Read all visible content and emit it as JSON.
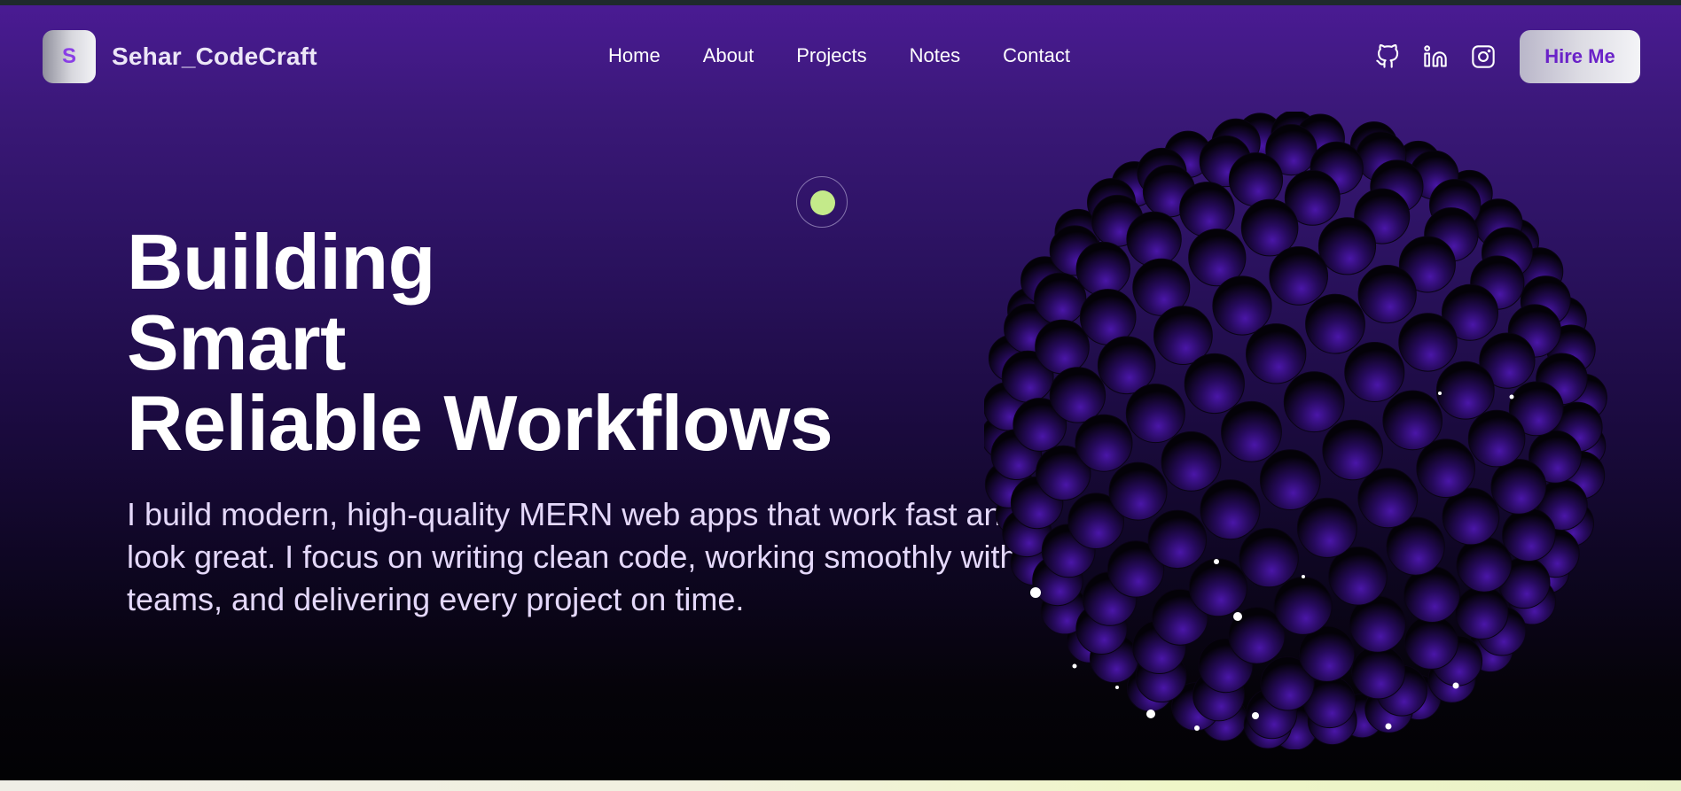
{
  "brand": {
    "logo_letter": "S",
    "name": "Sehar_CodeCraft"
  },
  "nav": {
    "items": [
      "Home",
      "About",
      "Projects",
      "Notes",
      "Contact"
    ]
  },
  "socials": [
    "github-icon",
    "linkedin-icon",
    "instagram-icon"
  ],
  "hire_button": "Hire Me",
  "hero": {
    "headline_lines": [
      "Building",
      "Smart",
      "Reliable Workflows"
    ],
    "subtitle": "I build modern, high-quality MERN web apps that work fast and look great. I focus on writing clean code, working smoothly with teams, and delivering every project on time."
  },
  "colors": {
    "accent_purple": "#8a3ee6",
    "cursor_green": "#c4ea8a",
    "background_top": "#4a1b93",
    "background_bottom": "#020204"
  }
}
